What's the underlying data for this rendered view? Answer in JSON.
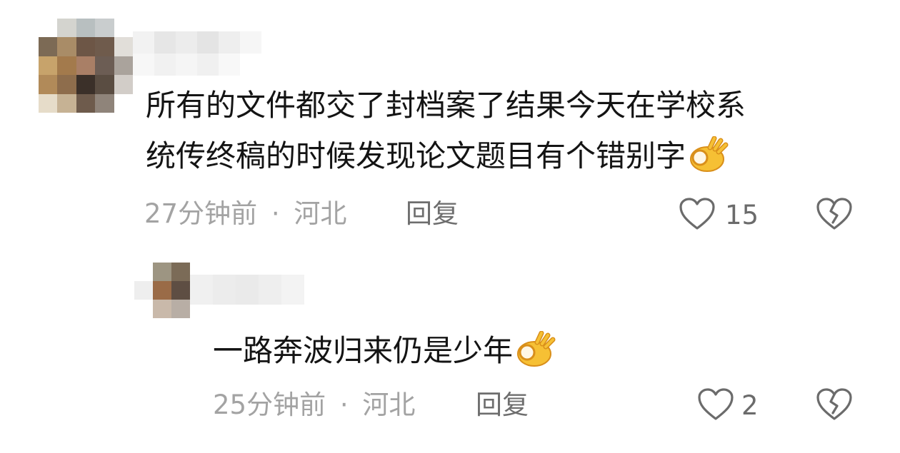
{
  "comments": [
    {
      "text_line1": "所有的文件都交了封档案了结果今天在学校系",
      "text_line2": "统传终稿的时候发现论文题目有个错别字",
      "emoji": "ok-hand",
      "time": "27分钟前",
      "separator": "·",
      "location": "河北",
      "reply_label": "回复",
      "like_count": "15"
    },
    {
      "text": "一路奔波归来仍是少年",
      "emoji": "ok-hand",
      "time": "25分钟前",
      "separator": "·",
      "location": "河北",
      "reply_label": "回复",
      "like_count": "2"
    }
  ],
  "colors": {
    "text": "#141414",
    "meta": "#a3a3a3",
    "reply": "#6e6e6e",
    "icon": "#6b6b6b"
  }
}
